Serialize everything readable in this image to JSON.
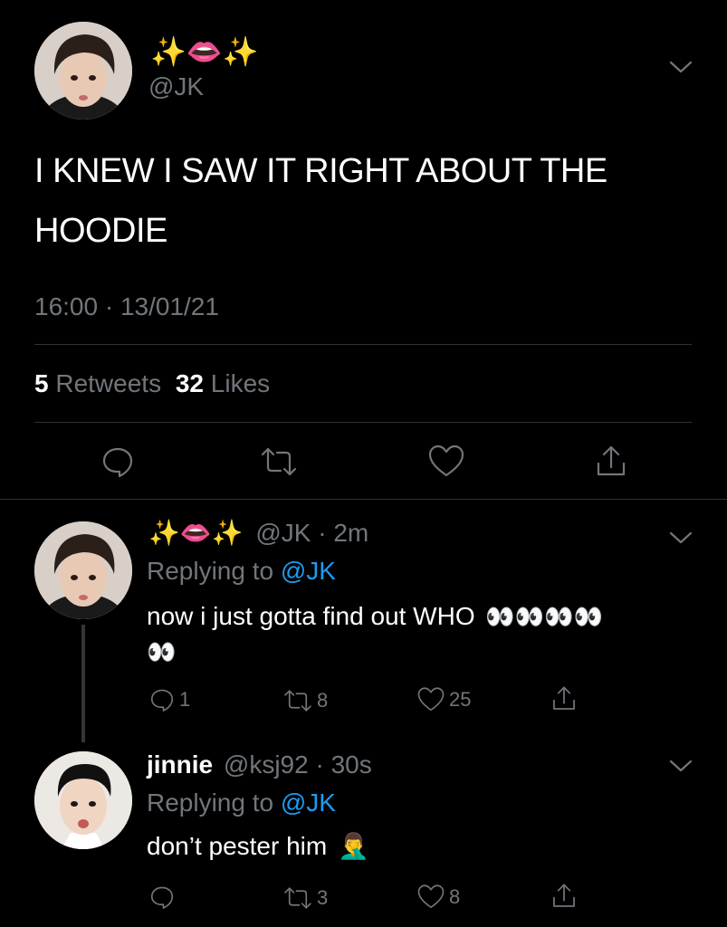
{
  "main_tweet": {
    "display_name_emoji": "✨👄✨",
    "handle": "@JK",
    "text_line1": "I KNEW I SAW IT RIGHT ABOUT THE",
    "text_line2": "HOODIE",
    "timestamp": "16:00 · 13/01/21",
    "retweets_count": "5",
    "retweets_label": "Retweets",
    "likes_count": "32",
    "likes_label": "Likes"
  },
  "reply1": {
    "display_name_emoji": "✨👄✨",
    "handle_time": "@JK · 2m",
    "replying_prefix": "Replying to",
    "replying_handle": "@JK",
    "text": "now i just gotta find out WHO",
    "text_emoji_line1": "👀👀👀👀",
    "text_emoji_line2": "👀",
    "reply_count": "1",
    "retweet_count": "8",
    "like_count": "25"
  },
  "reply2": {
    "display_name": "jinnie",
    "handle_time": "@ksj92 · 30s",
    "replying_prefix": "Replying to",
    "replying_handle": "@JK",
    "text": "don’t pester him",
    "text_emoji": "🤦‍♂️",
    "reply_count": "",
    "retweet_count": "3",
    "like_count": "8"
  },
  "colors": {
    "background": "#000000",
    "secondary_text": "#71767b",
    "link": "#1d9bf0",
    "divider": "#2f3336"
  }
}
